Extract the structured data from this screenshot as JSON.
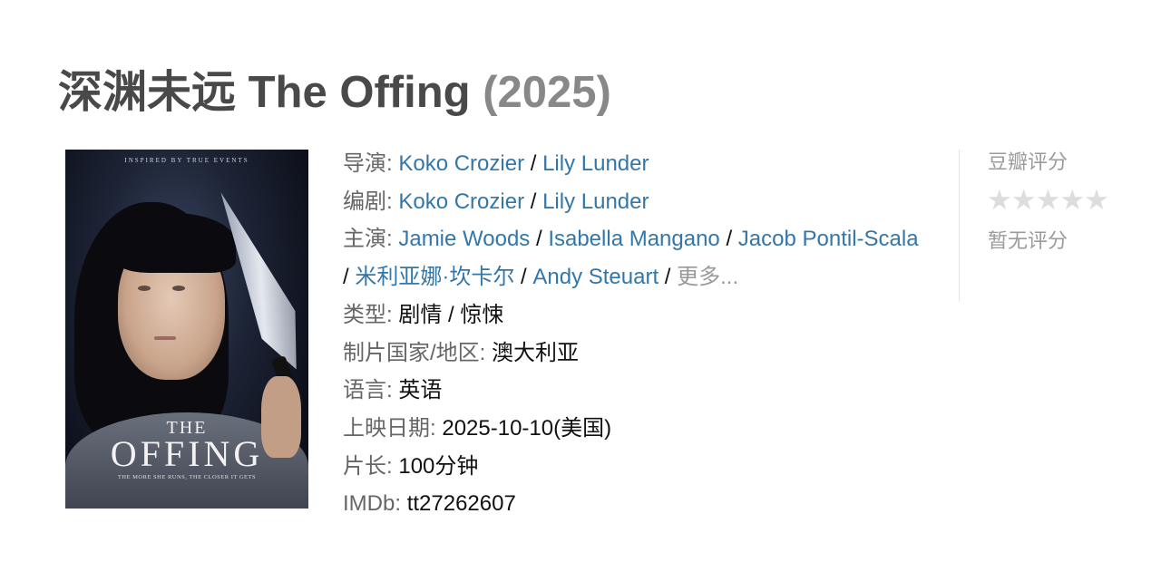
{
  "header": {
    "title_main": "深渊未远 The Offing",
    "year": "(2025)"
  },
  "poster": {
    "tagline": "INSPIRED BY TRUE EVENTS",
    "title_top": "THE",
    "title": "OFFING",
    "subtitle": "THE MORE SHE RUNS, THE CLOSER IT GETS"
  },
  "info": {
    "director_label": "导演",
    "directors": [
      "Koko Crozier",
      "Lily Lunder"
    ],
    "writer_label": "编剧",
    "writers": [
      "Koko Crozier",
      "Lily Lunder"
    ],
    "cast_label": "主演",
    "cast": [
      "Jamie Woods",
      "Isabella Mangano",
      "Jacob Pontil-Scala",
      "米利亚娜·坎卡尔",
      "Andy Steuart"
    ],
    "cast_more": "更多...",
    "genre_label": "类型",
    "genres": [
      "剧情",
      "惊悚"
    ],
    "country_label": "制片国家/地区",
    "country": "澳大利亚",
    "language_label": "语言",
    "language": "英语",
    "release_label": "上映日期",
    "release": "2025-10-10(美国)",
    "runtime_label": "片长",
    "runtime": "100分钟",
    "imdb_label": "IMDb",
    "imdb": "tt27262607"
  },
  "rating": {
    "label": "豆瓣评分",
    "stars": "★★★★★",
    "stars_filled": 0,
    "stars_total": 5,
    "none_text": "暂无评分"
  },
  "colors": {
    "link": "#3377aa",
    "label": "#666666",
    "title": "#494949",
    "year": "#888888",
    "muted": "#999999"
  }
}
